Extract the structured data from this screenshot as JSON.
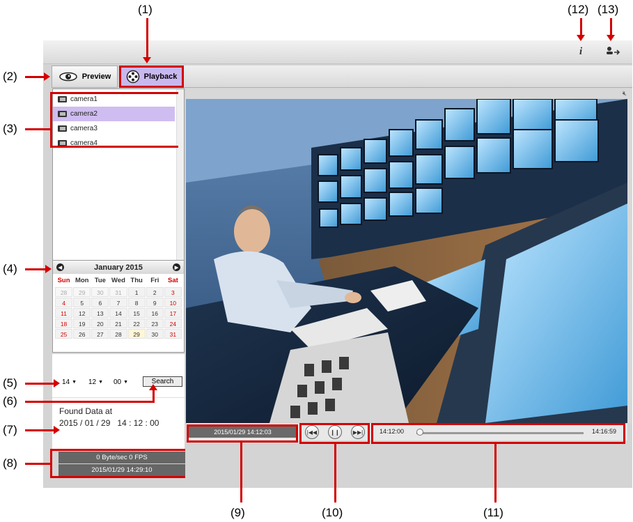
{
  "callouts": {
    "c1": "(1)",
    "c2": "(2)",
    "c3": "(3)",
    "c4": "(4)",
    "c5": "(5)",
    "c6": "(6)",
    "c7": "(7)",
    "c8": "(8)",
    "c9": "(9)",
    "c10": "(10)",
    "c11": "(11)",
    "c12": "(12)",
    "c13": "(13)"
  },
  "tabs": {
    "preview": "Preview",
    "playback": "Playback"
  },
  "cameras": [
    "camera1",
    "camera2",
    "camera3",
    "camera4"
  ],
  "selected_camera": "camera2",
  "calendar": {
    "month": "January 2015",
    "weekdays": [
      "Sun",
      "Mon",
      "Tue",
      "Wed",
      "Thu",
      "Fri",
      "Sat"
    ],
    "weeks": [
      [
        "28",
        "29",
        "30",
        "31",
        "1",
        "2",
        "3"
      ],
      [
        "4",
        "5",
        "6",
        "7",
        "8",
        "9",
        "10"
      ],
      [
        "11",
        "12",
        "13",
        "14",
        "15",
        "16",
        "17"
      ],
      [
        "18",
        "19",
        "20",
        "21",
        "22",
        "23",
        "24"
      ],
      [
        "25",
        "26",
        "27",
        "28",
        "29",
        "30",
        "31"
      ]
    ],
    "highlighted_day": "29"
  },
  "time_select": {
    "hour": "14",
    "minute": "12",
    "second": "00"
  },
  "search_label": "Search",
  "found": {
    "label": "Found Data at",
    "date": "2015 / 01 / 29",
    "time": "14 : 12 : 00"
  },
  "status": {
    "rate": "0 Byte/sec  0 FPS",
    "clock": "2015/01/29 14:29:10"
  },
  "playback": {
    "current_time": "2015/01/29 14:12:03",
    "timeline_start": "14:12:00",
    "timeline_end": "14:16:59",
    "progress": 0.02
  },
  "colors": {
    "accent": "#c9b8ee",
    "annotation": "#d40000",
    "status_bar": "#666666"
  },
  "icons": {
    "info": "info-icon",
    "logout": "logout-icon",
    "preview": "eye-icon",
    "playback": "film-reel-icon",
    "rewind": "skip-back-icon",
    "pause": "pause-icon",
    "forward": "skip-forward-icon",
    "volume": "volume-mute-icon"
  }
}
